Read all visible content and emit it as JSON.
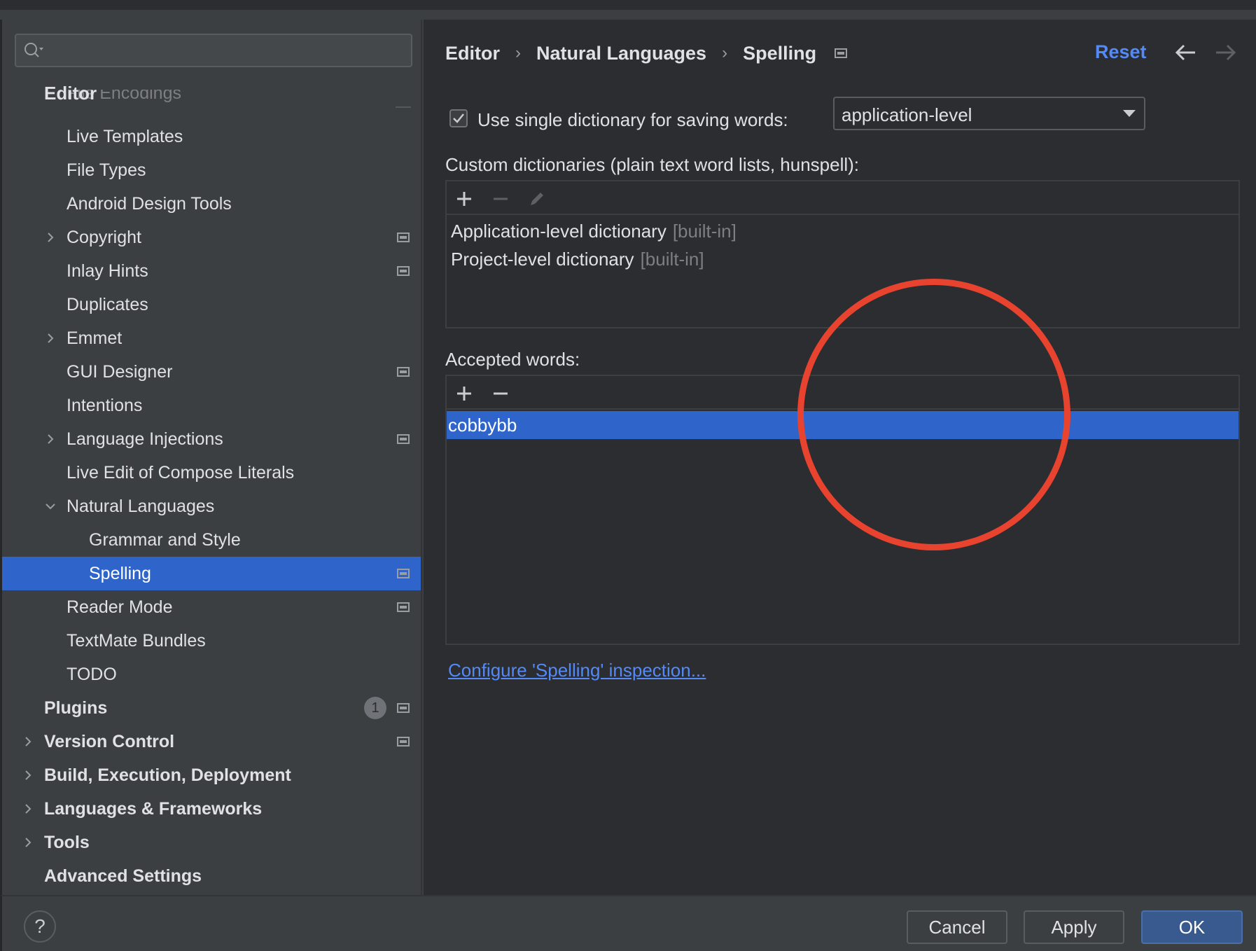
{
  "search": {
    "placeholder": ""
  },
  "sidebar": {
    "ghost_item": "File Encodings",
    "section_header": "Editor",
    "items": [
      {
        "label": "Live Templates"
      },
      {
        "label": "File Types"
      },
      {
        "label": "Android Design Tools"
      },
      {
        "label": "Copyright"
      },
      {
        "label": "Inlay Hints"
      },
      {
        "label": "Duplicates"
      },
      {
        "label": "Emmet"
      },
      {
        "label": "GUI Designer"
      },
      {
        "label": "Intentions"
      },
      {
        "label": "Language Injections"
      },
      {
        "label": "Live Edit of Compose Literals"
      },
      {
        "label": "Natural Languages"
      },
      {
        "label": "Grammar and Style"
      },
      {
        "label": "Spelling"
      },
      {
        "label": "Reader Mode"
      },
      {
        "label": "TextMate Bundles"
      },
      {
        "label": "TODO"
      },
      {
        "label": "Plugins",
        "badge": "1"
      },
      {
        "label": "Version Control"
      },
      {
        "label": "Build, Execution, Deployment"
      },
      {
        "label": "Languages & Frameworks"
      },
      {
        "label": "Tools"
      },
      {
        "label": "Advanced Settings"
      }
    ]
  },
  "header": {
    "breadcrumb": [
      "Editor",
      "Natural Languages",
      "Spelling"
    ],
    "breadcrumb_separator": "›",
    "reset_label": "Reset"
  },
  "spelling": {
    "checkbox_label": "Use single dictionary for saving words:",
    "checkbox_checked": true,
    "dropdown_value": "application-level",
    "custom_dict_label": "Custom dictionaries (plain text word lists, hunspell):",
    "dictionaries": [
      {
        "name": "Application-level dictionary",
        "tag": "[built-in]"
      },
      {
        "name": "Project-level dictionary",
        "tag": "[built-in]"
      }
    ],
    "accepted_label": "Accepted words:",
    "accepted_words": [
      "cobbybb"
    ],
    "configure_link": "Configure 'Spelling' inspection..."
  },
  "footer": {
    "help_label": "?",
    "cancel_label": "Cancel",
    "apply_label": "Apply",
    "ok_label": "OK"
  },
  "colors": {
    "accent": "#2f65ca",
    "link": "#548af7",
    "annotation": "#e8432f"
  }
}
